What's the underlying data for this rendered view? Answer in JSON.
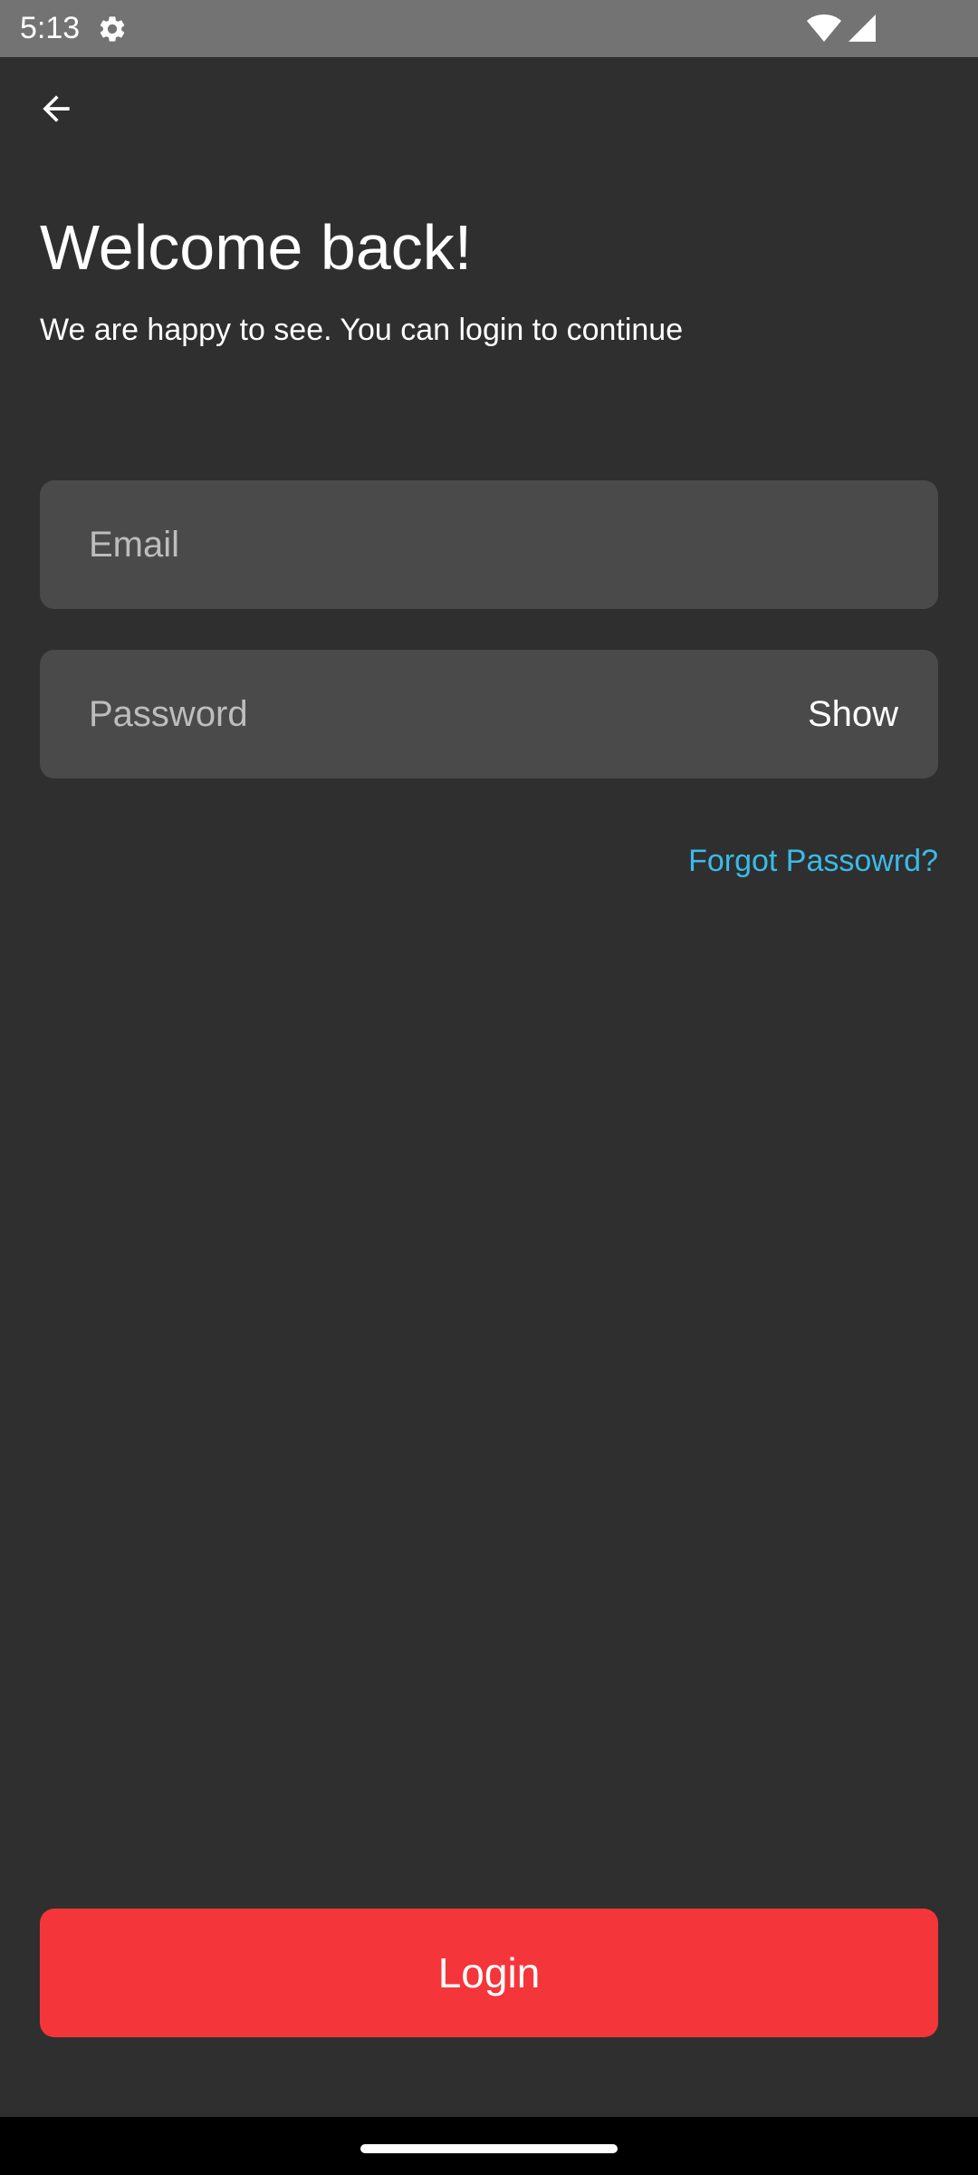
{
  "status_bar": {
    "time": "5:13",
    "icons": [
      "gear-icon",
      "wifi-icon",
      "signal-icon"
    ]
  },
  "header": {
    "back_icon": "arrow-left-icon"
  },
  "login": {
    "title": "Welcome back!",
    "subtitle": "We are happy to see. You can login to continue",
    "email": {
      "value": "",
      "placeholder": "Email"
    },
    "password": {
      "value": "",
      "placeholder": "Password",
      "toggle_label": "Show"
    },
    "forgot_label": "Forgot Passowrd?",
    "submit_label": "Login"
  },
  "colors": {
    "background": "#2f2f2f",
    "field_background": "#4a4a4a",
    "link": "#3bbbe8",
    "primary_button": "#f4363a",
    "status_bar": "#737373"
  }
}
